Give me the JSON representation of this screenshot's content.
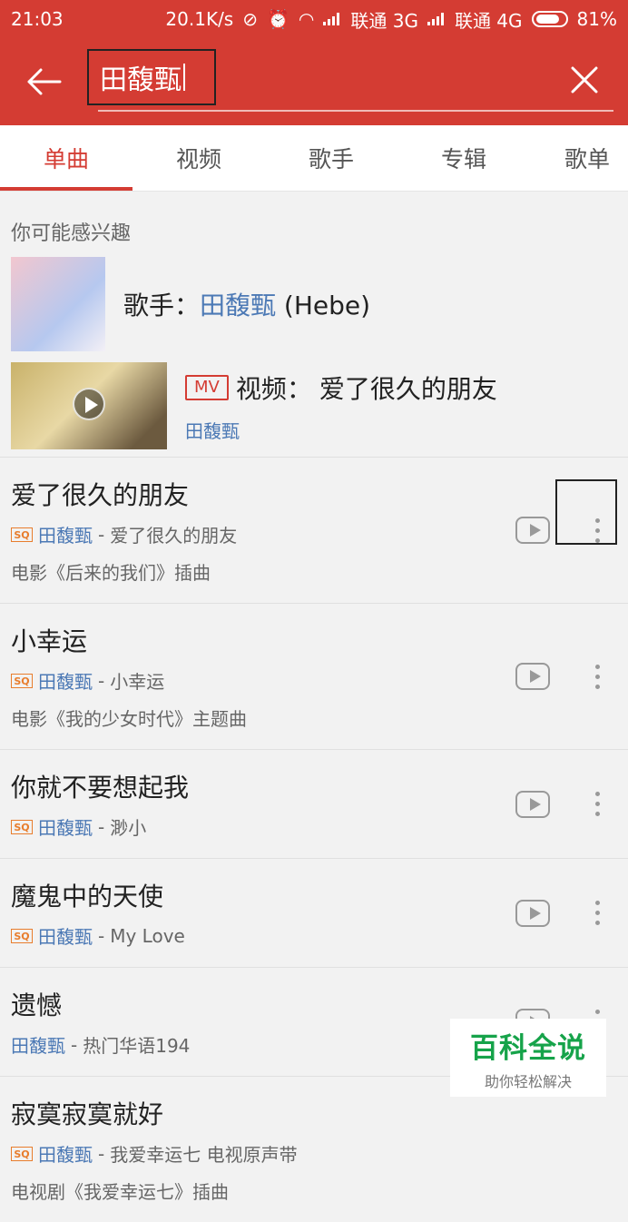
{
  "status": {
    "time": "21:03",
    "speed": "20.1K/s",
    "carrier1": "联通 3G",
    "carrier2": "联通 4G",
    "battery": "81%"
  },
  "search": {
    "query": "田馥甄"
  },
  "tabs": [
    "单曲",
    "视频",
    "歌手",
    "专辑",
    "歌单"
  ],
  "section_title": "你可能感兴趣",
  "suggestions": {
    "singer": {
      "prefix": "歌手：",
      "name": "田馥甄",
      "suffix": " (Hebe)"
    },
    "video": {
      "badge": "MV",
      "prefix": "视频：",
      "title": "爱了很久的朋友",
      "artist": "田馥甄"
    }
  },
  "songs": [
    {
      "title": "爱了很久的朋友",
      "artist": "田馥甄",
      "album": "爱了很久的朋友",
      "desc": "电影《后来的我们》插曲",
      "sq": "SQ"
    },
    {
      "title": "小幸运",
      "artist": "田馥甄",
      "album": "小幸运",
      "desc": "电影《我的少女时代》主题曲",
      "sq": "SQ"
    },
    {
      "title": "你就不要想起我",
      "artist": "田馥甄",
      "album": "渺小",
      "sq": "SQ"
    },
    {
      "title": "魔鬼中的天使",
      "artist": "田馥甄",
      "album": "My Love",
      "sq": "SQ"
    },
    {
      "title": "遗憾",
      "artist": "田馥甄",
      "album": "热门华语194"
    },
    {
      "title": "寂寞寂寞就好",
      "artist": "田馥甄",
      "album": "我爱幸运七 电视原声带",
      "desc": "电视剧《我爱幸运七》插曲",
      "sq": "SQ"
    }
  ],
  "watermark": {
    "title": "百科全说",
    "subtitle": "助你轻松解决"
  }
}
